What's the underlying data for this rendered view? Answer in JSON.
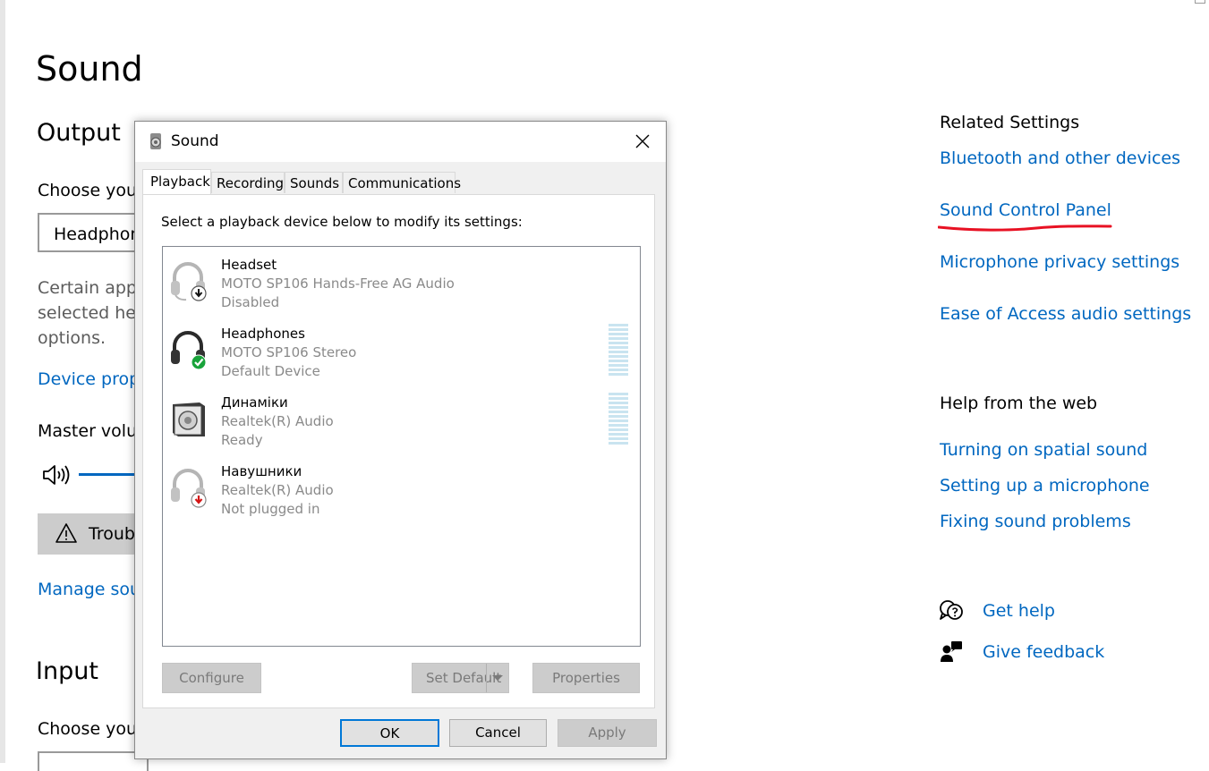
{
  "settings": {
    "page_title": "Sound",
    "output_heading": "Output",
    "choose_output_label": "Choose you",
    "output_device_value": "Headphon",
    "certain_apps_text": [
      "Certain app",
      "selected her",
      "options."
    ],
    "device_properties_link": "Device prop",
    "master_volume_label": "Master volu",
    "troubleshoot_label": "Troub",
    "manage_sound_link": "Manage sou",
    "input_heading": "Input",
    "choose_input_label": "Choose you"
  },
  "related": {
    "heading": "Related Settings",
    "links": [
      "Bluetooth and other devices",
      "Sound Control Panel",
      "Microphone privacy settings",
      "Ease of Access audio settings"
    ],
    "highlight_color": "#e81123"
  },
  "help": {
    "heading": "Help from the web",
    "links": [
      "Turning on spatial sound",
      "Setting up a microphone",
      "Fixing sound problems"
    ],
    "get_help": "Get help",
    "give_feedback": "Give feedback"
  },
  "dialog": {
    "title": "Sound",
    "tabs": [
      "Playback",
      "Recording",
      "Sounds",
      "Communications"
    ],
    "active_tab": "Playback",
    "instruction": "Select a playback device below to modify its settings:",
    "devices": [
      {
        "name": "Headset",
        "description": "MOTO SP106 Hands-Free AG Audio",
        "state": "Disabled",
        "icon": "headset-disabled-icon"
      },
      {
        "name": "Headphones",
        "description": "MOTO SP106 Stereo",
        "state": "Default Device",
        "icon": "headphones-default-icon"
      },
      {
        "name": "Динаміки",
        "description": "Realtek(R) Audio",
        "state": "Ready",
        "icon": "speaker-icon"
      },
      {
        "name": "Навушники",
        "description": "Realtek(R) Audio",
        "state": "Not plugged in",
        "icon": "headphones-unplugged-icon"
      }
    ],
    "buttons": {
      "configure": "Configure",
      "set_default": "Set Default",
      "properties": "Properties",
      "ok": "OK",
      "cancel": "Cancel",
      "apply": "Apply"
    }
  }
}
